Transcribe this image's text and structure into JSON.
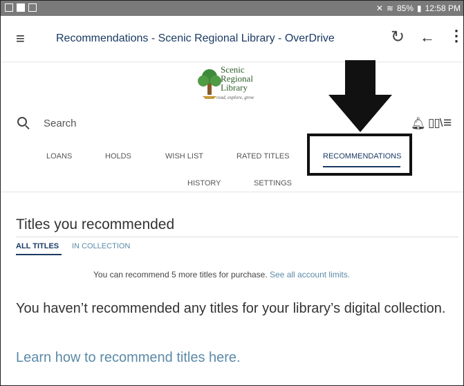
{
  "status_bar": {
    "battery": "85%",
    "time": "12:58 PM"
  },
  "app_bar": {
    "title": "Recommendations - Scenic Regional Library - OverDrive"
  },
  "logo": {
    "line1": "Scenic",
    "line2": "Regional",
    "line3": "Library",
    "tagline": "read, explore, grow"
  },
  "search": {
    "label": "Search"
  },
  "tabs": {
    "loans": "LOANS",
    "holds": "HOLDS",
    "wish_list": "WISH LIST",
    "rated_titles": "RATED TITLES",
    "recommendations": "RECOMMENDATIONS",
    "history": "HISTORY",
    "settings": "SETTINGS"
  },
  "content": {
    "heading": "Titles you recommended",
    "subtab_all": "ALL TITLES",
    "subtab_collection": "IN COLLECTION",
    "limit_text": "You can recommend 5 more titles for purchase.",
    "limit_link": "See all account limits.",
    "message": "You haven’t recommended any titles for your library’s digital collection.",
    "learn_link": "Learn how to recommend titles here."
  },
  "colors": {
    "brand_navy": "#1a3a63",
    "link_blue": "#5b8aa8",
    "status_bar": "#7a7a7a"
  }
}
